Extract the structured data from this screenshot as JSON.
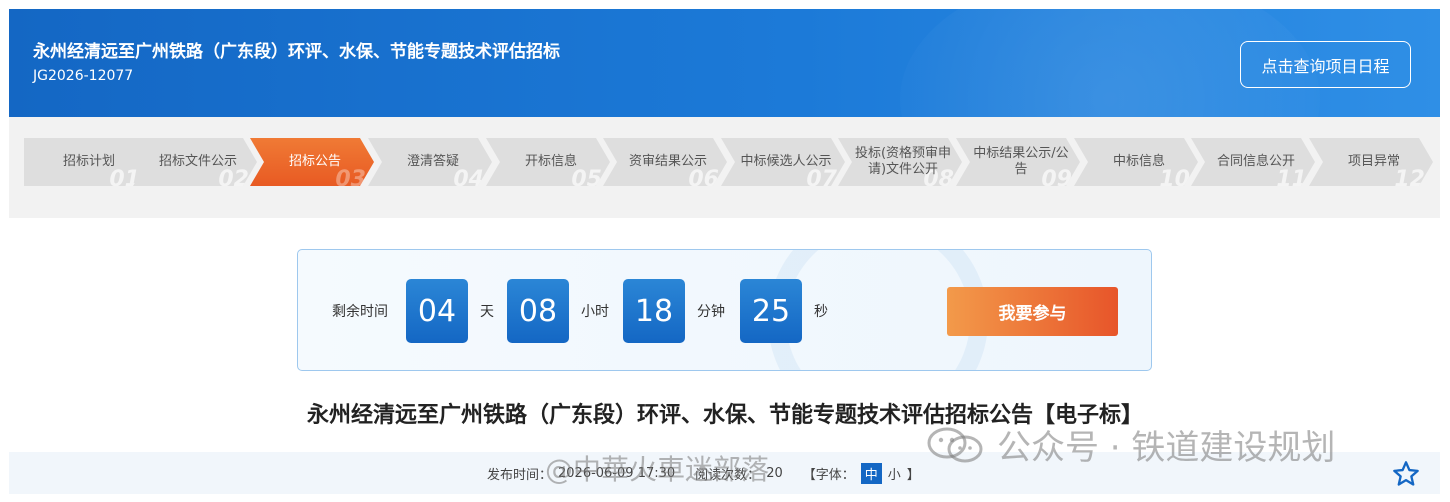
{
  "header": {
    "title": "永州经清远至广州铁路（广东段）环评、水保、节能专题技术评估招标",
    "code": "JG2026-12077",
    "schedule_button": "点击查询项目日程"
  },
  "steps": [
    {
      "label": "招标计划",
      "num": "01"
    },
    {
      "label": "招标文件公示",
      "num": "02"
    },
    {
      "label": "招标公告",
      "num": "03",
      "active": true
    },
    {
      "label": "澄清答疑",
      "num": "04"
    },
    {
      "label": "开标信息",
      "num": "05"
    },
    {
      "label": "资审结果公示",
      "num": "06"
    },
    {
      "label": "中标候选人公示",
      "num": "07"
    },
    {
      "label": "投标(资格预审申请)文件公开",
      "num": "08"
    },
    {
      "label": "中标结果公示/公告",
      "num": "09"
    },
    {
      "label": "中标信息",
      "num": "10"
    },
    {
      "label": "合同信息公开",
      "num": "11"
    },
    {
      "label": "项目异常",
      "num": "12"
    }
  ],
  "countdown": {
    "label": "剩余时间",
    "days": "04",
    "days_unit": "天",
    "hours": "08",
    "hours_unit": "小时",
    "minutes": "18",
    "minutes_unit": "分钟",
    "seconds": "25",
    "seconds_unit": "秒",
    "join_button": "我要参与"
  },
  "article": {
    "title": "永州经清远至广州铁路（广东段）环评、水保、节能专题技术评估招标公告【电子标】",
    "publish_label": "发布时间：",
    "publish_value": "2026-06-09 17:30",
    "views_label": "阅读次数：",
    "views_value": "20",
    "font_label": "【字体：",
    "font_mid": "中",
    "font_small": "小",
    "font_close": "】"
  },
  "watermarks": {
    "left": "@中華火車迷部落",
    "right": "公众号 · 铁道建设规划"
  },
  "colors": {
    "primary": "#1467c4",
    "accent": "#e85a23"
  }
}
